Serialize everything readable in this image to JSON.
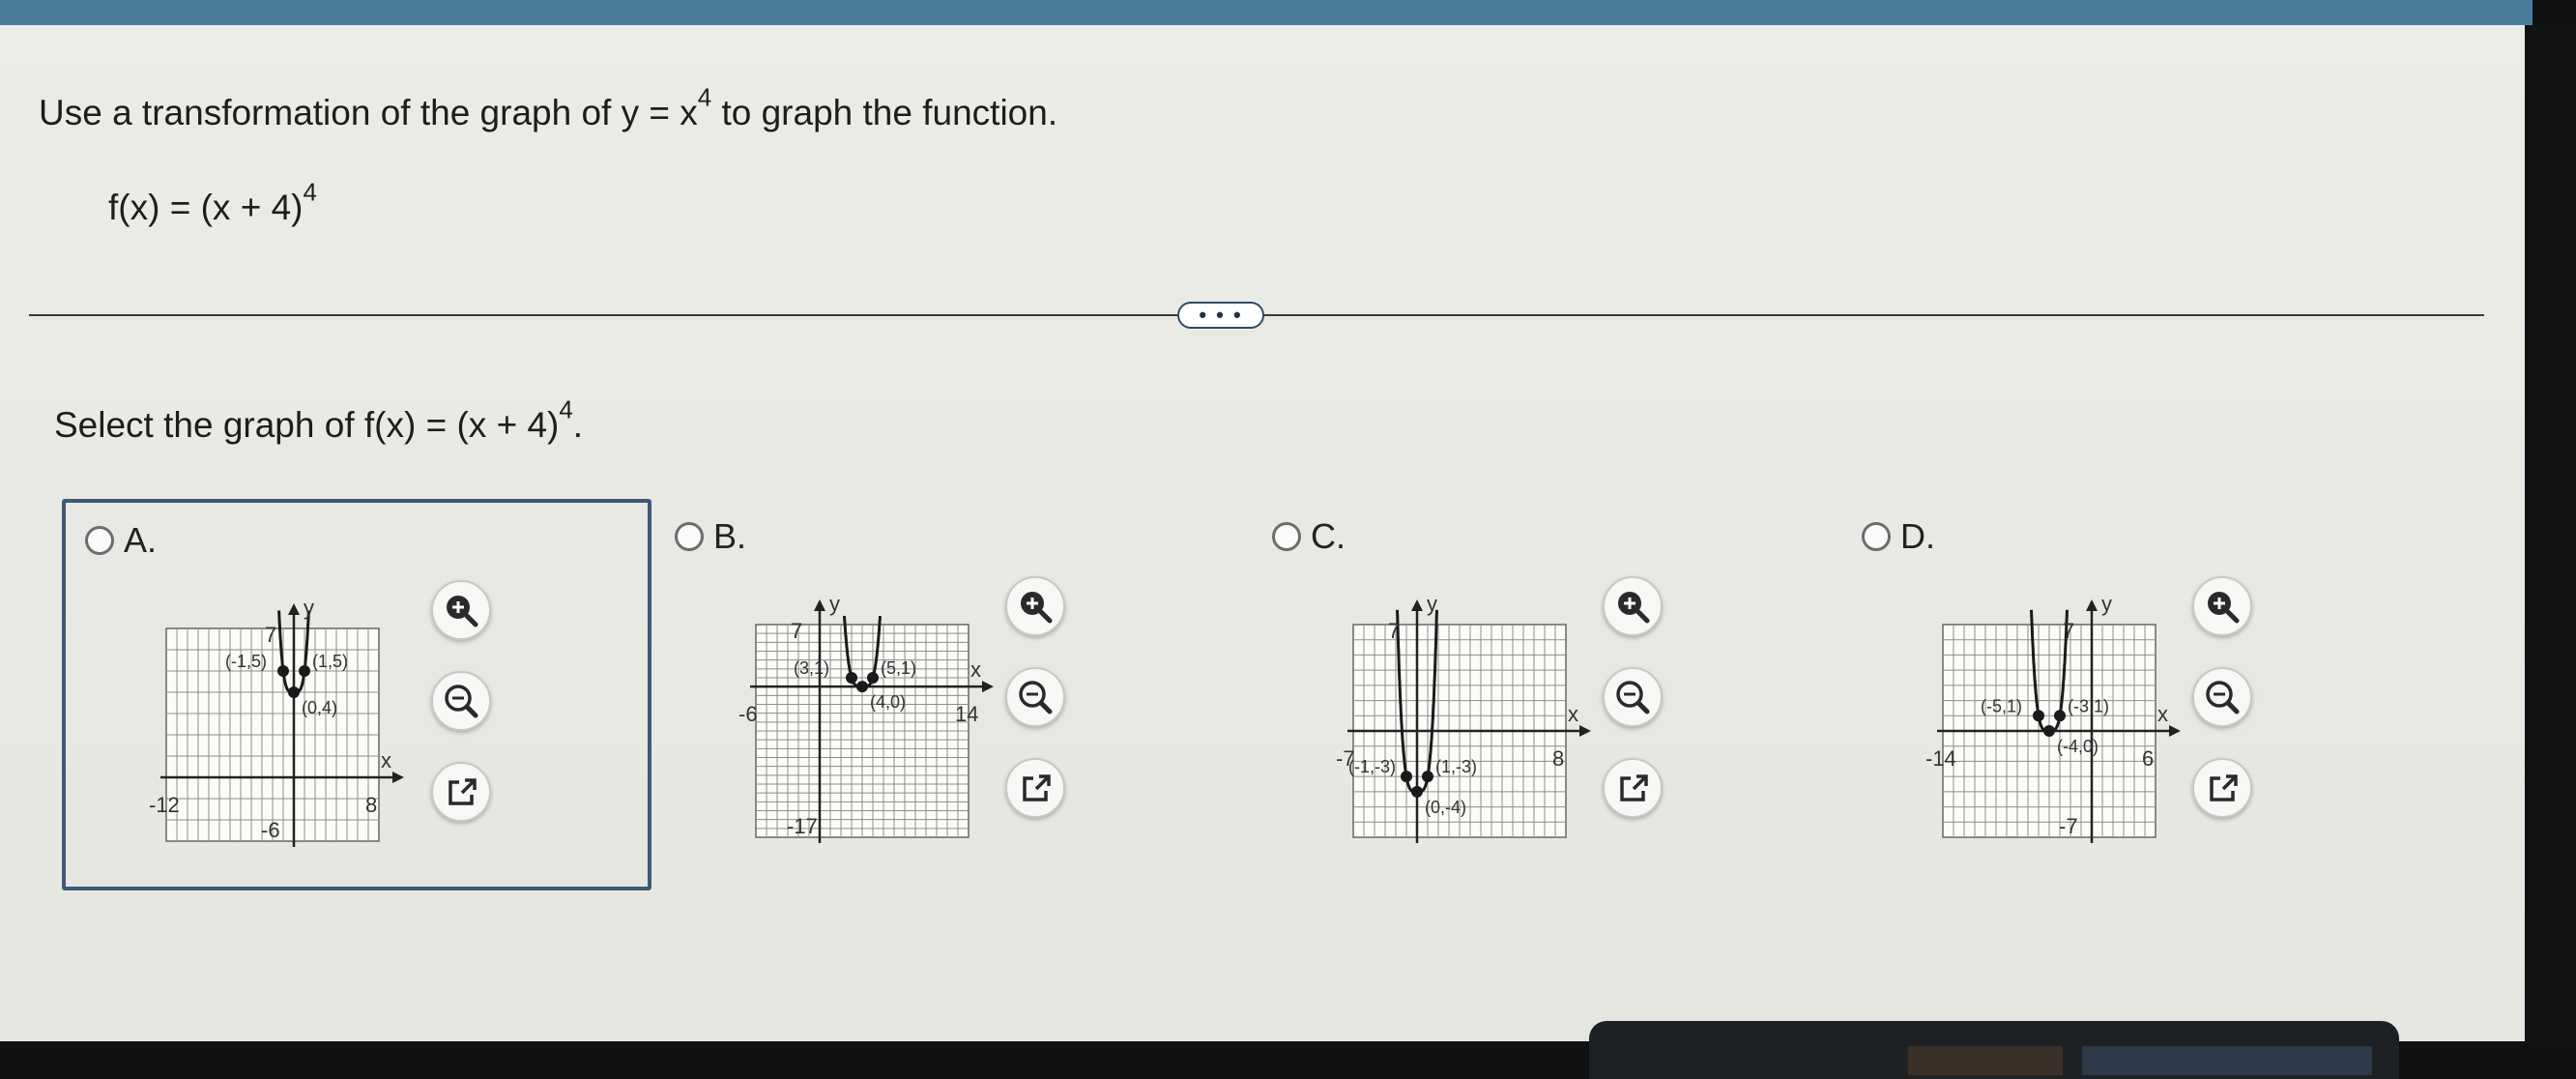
{
  "question": {
    "instruction_prefix": "Use a transformation of the graph of y = x",
    "instruction_exp": "4",
    "instruction_suffix": " to graph the function.",
    "function_base": "f(x) = (x + 4)",
    "function_exp": "4"
  },
  "expand_button_label": "• • •",
  "prompt": {
    "prefix": "Select the graph of f(x) = (x + 4)",
    "exp": "4",
    "suffix": "."
  },
  "options": [
    {
      "label": "A.",
      "selected": true,
      "graph": {
        "xmin": -12,
        "xmax": 8,
        "ymin": -3,
        "ymax": 7,
        "points": [
          [
            "-1,5",
            -1,
            5
          ],
          [
            "1,5",
            1,
            5
          ],
          [
            "0,4",
            0,
            4
          ]
        ],
        "tick_labels": [
          "7",
          "-12",
          "8",
          "-6"
        ],
        "axis_labels": [
          "y",
          "x"
        ]
      }
    },
    {
      "label": "B.",
      "selected": false,
      "graph": {
        "xmin": -6,
        "xmax": 14,
        "ymin": -17,
        "ymax": 7,
        "points": [
          [
            "3,1",
            3,
            1
          ],
          [
            "5,1",
            5,
            1
          ],
          [
            "4,0",
            4,
            0
          ]
        ],
        "tick_labels": [
          "7",
          "-6",
          "14",
          "-17"
        ],
        "axis_labels": [
          "y",
          "x"
        ]
      }
    },
    {
      "label": "C.",
      "selected": false,
      "graph": {
        "xmin": -6,
        "xmax": 14,
        "ymin": -7,
        "ymax": 7,
        "points": [
          [
            "-1,-3",
            -1,
            -3
          ],
          [
            "1,-3",
            1,
            -3
          ],
          [
            "0,-4",
            0,
            -4
          ]
        ],
        "tick_labels": [
          "7",
          "-7",
          "8"
        ],
        "axis_labels": [
          "y",
          "x"
        ]
      }
    },
    {
      "label": "D.",
      "selected": false,
      "graph": {
        "xmin": -14,
        "xmax": 6,
        "ymin": -7,
        "ymax": 7,
        "points": [
          [
            "-5,1",
            -5,
            1
          ],
          [
            "-3,1",
            -3,
            1
          ],
          [
            "-4,0",
            -4,
            0
          ]
        ],
        "tick_labels": [
          "7",
          "-14",
          "6",
          "-7"
        ],
        "axis_labels": [
          "y",
          "x"
        ]
      }
    }
  ],
  "tool_icons": [
    "zoom-in-icon",
    "zoom-out-icon",
    "open-external-icon"
  ],
  "colors": {
    "topbar": "#4a7d9b",
    "selected_border": "#3d5a77",
    "panel": "#e8e8e4"
  }
}
